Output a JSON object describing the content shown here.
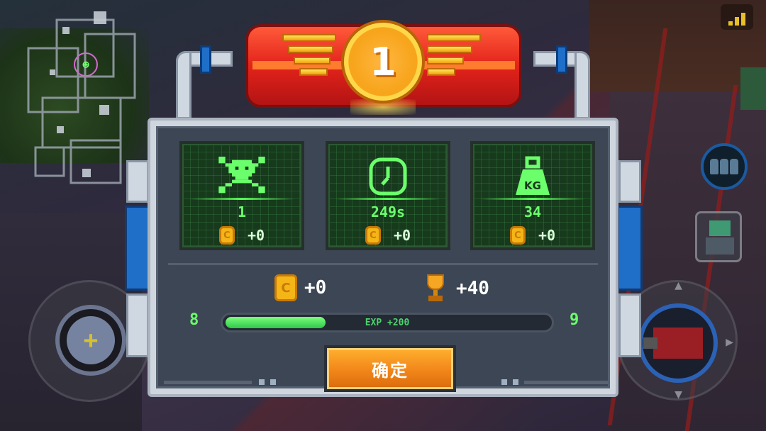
{
  "rank": "1",
  "stats": [
    {
      "id": "kills",
      "icon": "skull-icon",
      "value": "1",
      "coin_reward": "+0"
    },
    {
      "id": "time",
      "icon": "clock-icon",
      "value": "249s",
      "coin_reward": "+0"
    },
    {
      "id": "weight",
      "icon": "weight-icon",
      "icon_label": "KG",
      "value": "34",
      "coin_reward": "+0"
    }
  ],
  "summary": {
    "coins": "+0",
    "trophies": "+40"
  },
  "experience": {
    "current_level": "8",
    "next_level": "9",
    "label": "EXP +200",
    "progress": 0.31
  },
  "confirm_label": "确定",
  "minimap_coin_label": "C",
  "colors": {
    "screen_green": "#6bff6b",
    "ribbon_red": "#e2231a",
    "medal_orange": "#f7a51c",
    "button_orange": "#f2861a",
    "coin_gold": "#f5b516"
  }
}
